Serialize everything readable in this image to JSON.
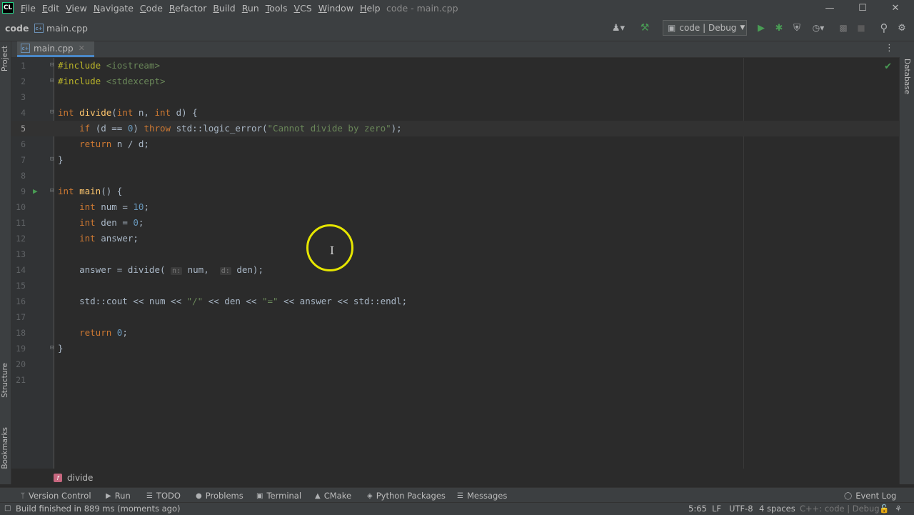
{
  "app": {
    "logo": "CL",
    "title": "code - main.cpp"
  },
  "menu": [
    {
      "u": "F",
      "rest": "ile"
    },
    {
      "u": "E",
      "rest": "dit"
    },
    {
      "u": "V",
      "rest": "iew"
    },
    {
      "u": "N",
      "rest": "avigate"
    },
    {
      "u": "C",
      "rest": "ode"
    },
    {
      "u": "R",
      "rest": "efactor"
    },
    {
      "u": "B",
      "rest": "uild"
    },
    {
      "u": "R",
      "rest": "un"
    },
    {
      "u": "T",
      "rest": "ools"
    },
    {
      "u": "V",
      "rest": "CS"
    },
    {
      "u": "W",
      "rest": "indow"
    },
    {
      "u": "H",
      "rest": "elp"
    }
  ],
  "navbar": {
    "project": "code",
    "file": "main.cpp",
    "run_config": "code | Debug"
  },
  "tab": {
    "label": "main.cpp"
  },
  "side_tabs": {
    "project": "Project",
    "structure": "Structure",
    "bookmarks": "Bookmarks",
    "database": "Database"
  },
  "editor": {
    "current_line": 5,
    "lines": [
      {
        "n": "1",
        "tokens": [
          [
            "pp",
            "#include "
          ],
          [
            "inc",
            "<iostream>"
          ]
        ]
      },
      {
        "n": "2",
        "tokens": [
          [
            "pp",
            "#include "
          ],
          [
            "inc",
            "<stdexcept>"
          ]
        ]
      },
      {
        "n": "3",
        "tokens": []
      },
      {
        "n": "4",
        "tokens": [
          [
            "kw",
            "int "
          ],
          [
            "fn",
            "divide"
          ],
          [
            "",
            "("
          ],
          [
            "kw",
            "int "
          ],
          [
            "",
            "n, "
          ],
          [
            "kw",
            "int "
          ],
          [
            "",
            "d) {"
          ]
        ]
      },
      {
        "n": "5",
        "tokens": [
          [
            "",
            "    "
          ],
          [
            "kw",
            "if "
          ],
          [
            "",
            "(d == "
          ],
          [
            "num",
            "0"
          ],
          [
            "",
            ") "
          ],
          [
            "kw",
            "throw "
          ],
          [
            "",
            "std::logic_error("
          ],
          [
            "str",
            "\"Cannot divide by zero\""
          ],
          [
            "",
            ");"
          ]
        ]
      },
      {
        "n": "6",
        "tokens": [
          [
            "",
            "    "
          ],
          [
            "kw",
            "return "
          ],
          [
            "",
            "n / d;"
          ]
        ]
      },
      {
        "n": "7",
        "tokens": [
          [
            "",
            "}"
          ]
        ]
      },
      {
        "n": "8",
        "tokens": []
      },
      {
        "n": "9",
        "tokens": [
          [
            "kw",
            "int "
          ],
          [
            "fn",
            "main"
          ],
          [
            "",
            "() {"
          ]
        ]
      },
      {
        "n": "10",
        "tokens": [
          [
            "",
            "    "
          ],
          [
            "kw",
            "int "
          ],
          [
            "",
            "num = "
          ],
          [
            "num",
            "10"
          ],
          [
            "",
            ";"
          ]
        ]
      },
      {
        "n": "11",
        "tokens": [
          [
            "",
            "    "
          ],
          [
            "kw",
            "int "
          ],
          [
            "",
            "den = "
          ],
          [
            "num",
            "0"
          ],
          [
            "",
            ";"
          ]
        ]
      },
      {
        "n": "12",
        "tokens": [
          [
            "",
            "    "
          ],
          [
            "kw",
            "int "
          ],
          [
            "",
            "answer;"
          ]
        ]
      },
      {
        "n": "13",
        "tokens": []
      },
      {
        "n": "14",
        "tokens": [
          [
            "",
            "    answer = divide( "
          ],
          [
            "hint",
            "n:"
          ],
          [
            "",
            " num,  "
          ],
          [
            "hint",
            "d:"
          ],
          [
            "",
            " den);"
          ]
        ]
      },
      {
        "n": "15",
        "tokens": []
      },
      {
        "n": "16",
        "tokens": [
          [
            "",
            "    std::cout << num << "
          ],
          [
            "str",
            "\"/\""
          ],
          [
            "",
            " << den << "
          ],
          [
            "str",
            "\"=\""
          ],
          [
            "",
            " << answer << std::endl;"
          ]
        ]
      },
      {
        "n": "17",
        "tokens": []
      },
      {
        "n": "18",
        "tokens": [
          [
            "",
            "    "
          ],
          [
            "kw",
            "return "
          ],
          [
            "num",
            "0"
          ],
          [
            "",
            ";"
          ]
        ]
      },
      {
        "n": "19",
        "tokens": [
          [
            "",
            "}"
          ]
        ]
      },
      {
        "n": "20",
        "tokens": []
      },
      {
        "n": "21",
        "tokens": []
      }
    ],
    "fold_lines": [
      1,
      2,
      4,
      7,
      9,
      19
    ],
    "run_marker_line": 9
  },
  "breadcrumb": {
    "icon": "f",
    "label": "divide"
  },
  "tool_windows": [
    {
      "icon": "version-control-icon",
      "glyph": "ᛘ",
      "label": "Version Control"
    },
    {
      "icon": "run-icon",
      "glyph": "▶",
      "label": "Run"
    },
    {
      "icon": "todo-icon",
      "glyph": "☰",
      "label": "TODO"
    },
    {
      "icon": "problems-icon",
      "glyph": "●",
      "label": "Problems"
    },
    {
      "icon": "terminal-icon",
      "glyph": "▣",
      "label": "Terminal"
    },
    {
      "icon": "cmake-icon",
      "glyph": "▲",
      "label": "CMake"
    },
    {
      "icon": "python-packages-icon",
      "glyph": "◈",
      "label": "Python Packages"
    },
    {
      "icon": "messages-icon",
      "glyph": "☰",
      "label": "Messages"
    }
  ],
  "event_log": "Event Log",
  "status": {
    "message": "Build finished in 889 ms (moments ago)",
    "position": "5:65",
    "line_sep": "LF",
    "encoding": "UTF-8",
    "indent": "4 spaces",
    "context": "C++: code | Debug"
  },
  "colors": {
    "accent": "#4a88c7",
    "run_green": "#499c54",
    "cursor_highlight": "#e6e600"
  }
}
